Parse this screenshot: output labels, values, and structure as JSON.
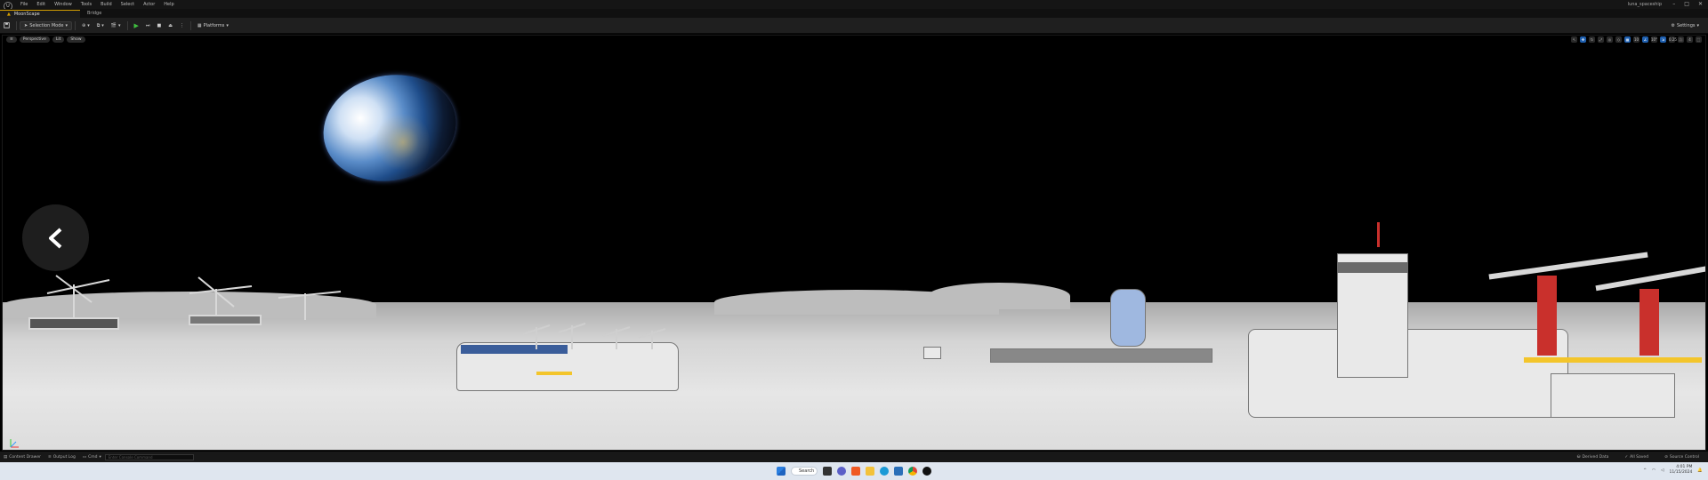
{
  "menubar": {
    "logo": "U",
    "items": [
      "File",
      "Edit",
      "Window",
      "Tools",
      "Build",
      "Select",
      "Actor",
      "Help"
    ],
    "project": "luna_spaceship",
    "controls": [
      "–",
      "□",
      "✕"
    ]
  },
  "tabs": [
    {
      "label": "MoonScape",
      "active": true
    },
    {
      "label": "Bridge",
      "active": false
    }
  ],
  "toolbar": {
    "save_icon": "save-icon",
    "mode_label": "Selection Mode",
    "platforms_label": "Platforms",
    "settings_label": "Settings"
  },
  "viewport": {
    "menu_icon": "≡",
    "perspective_label": "Perspective",
    "lit_label": "Lit",
    "show_label": "Show",
    "grid_snap": "10",
    "angle_snap": "10°",
    "scale_snap": "0.25",
    "camera_speed": "4"
  },
  "statusbar": {
    "content_drawer": "Content Drawer",
    "output_log": "Output Log",
    "cmd_label": "Cmd",
    "cmd_placeholder": "Enter Console Command",
    "derived_data": "Derived Data",
    "all_saved": "All Saved",
    "source_control": "Source Control"
  },
  "taskbar": {
    "search_label": "Search",
    "time": "4:01 PM",
    "date": "11/15/2024"
  },
  "colors": {
    "accent": "#d6a000",
    "play": "#3fbf3f",
    "viewport_bg": "#000000"
  }
}
